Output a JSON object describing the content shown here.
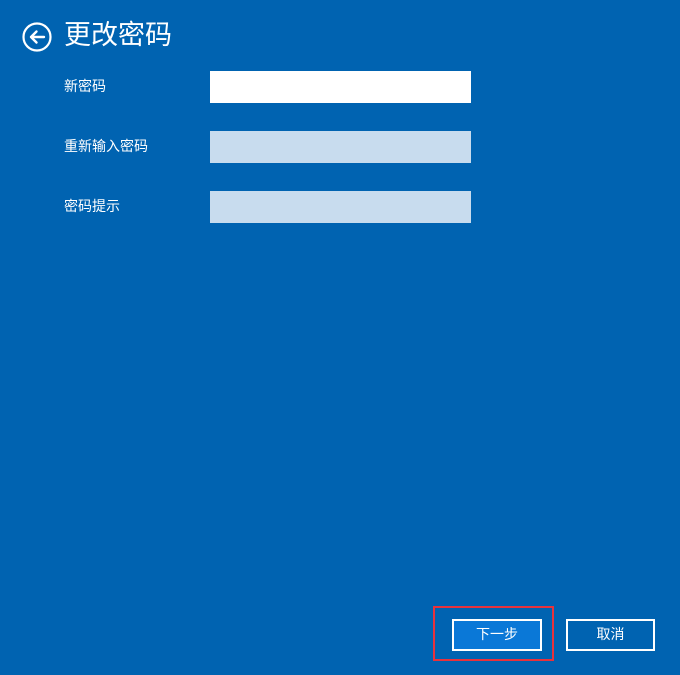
{
  "header": {
    "title": "更改密码",
    "back_icon": "back-arrow-circle-icon"
  },
  "form": {
    "fields": [
      {
        "label": "新密码",
        "value": "",
        "active": true
      },
      {
        "label": "重新输入密码",
        "value": "",
        "active": false
      },
      {
        "label": "密码提示",
        "value": "",
        "active": false
      }
    ]
  },
  "footer": {
    "next_label": "下一步",
    "cancel_label": "取消"
  },
  "colors": {
    "background": "#0063b1",
    "active_input": "#ffffff",
    "inactive_input": "#c8dcee",
    "highlight": "#e8323c"
  }
}
